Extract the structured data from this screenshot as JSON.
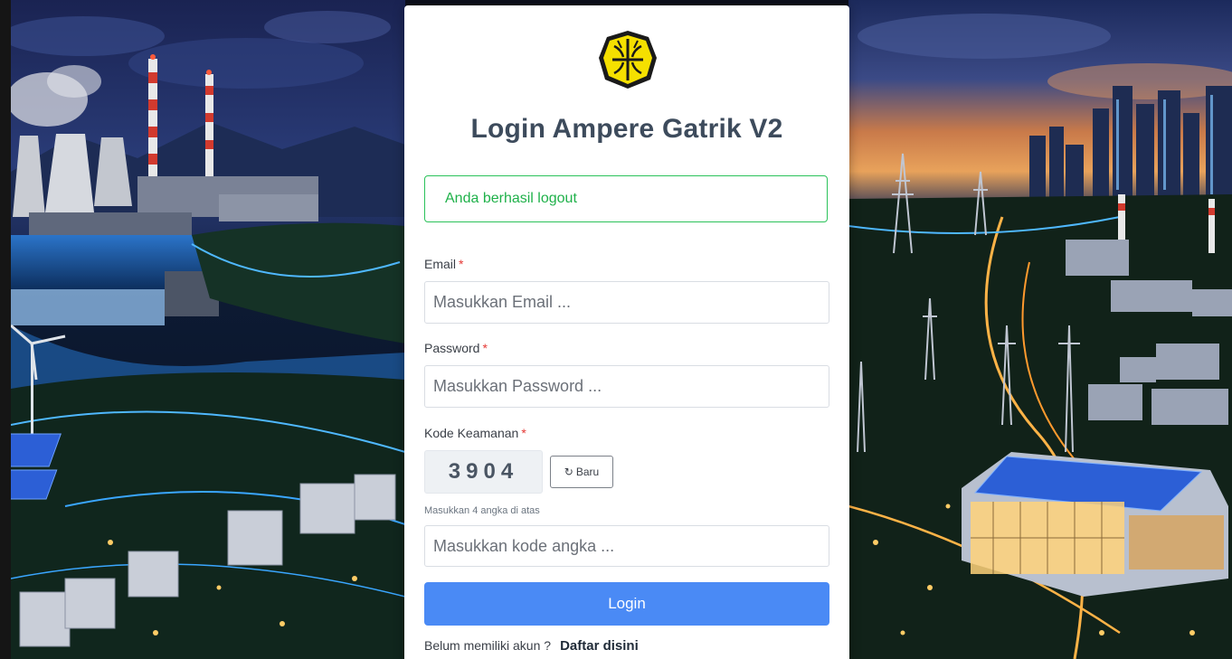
{
  "login": {
    "title": "Login Ampere Gatrik V2",
    "alert_message": "Anda berhasil logout",
    "email": {
      "label": "Email",
      "required_mark": "*",
      "placeholder": "Masukkan Email ...",
      "value": ""
    },
    "password": {
      "label": "Password",
      "required_mark": "*",
      "placeholder": "Masukkan Password ...",
      "value": ""
    },
    "security_code": {
      "label": "Kode Keamanan",
      "required_mark": "*",
      "captcha_code": "3904",
      "refresh_icon": "↻",
      "refresh_label": "Baru",
      "hint": "Masukkan 4 angka di atas",
      "placeholder": "Masukkan kode angka ...",
      "value": ""
    },
    "submit_label": "Login",
    "register_prompt": "Belum memiliki akun ?",
    "register_link": "Daftar disini"
  },
  "icons": {
    "logo": "ministry-emblem-icon",
    "refresh": "refresh-icon"
  },
  "colors": {
    "accent": "#4a8af5",
    "success": "#1fb14a",
    "required": "#e53935",
    "title": "#3d4b5c",
    "logo_yellow": "#f5e000"
  }
}
